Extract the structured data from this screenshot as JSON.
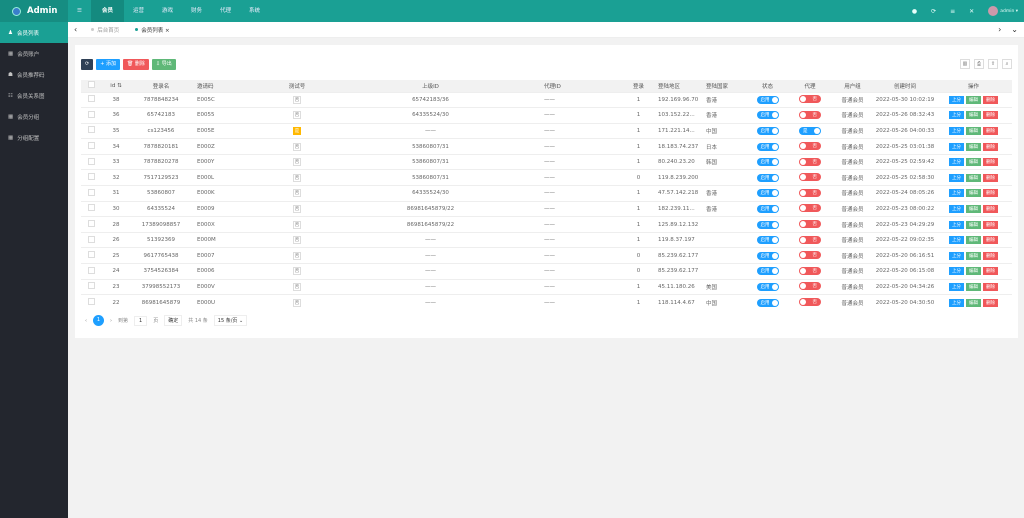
{
  "header": {
    "logo": "Admin",
    "nav": [
      "☰",
      "会员",
      "运营",
      "游戏",
      "财务",
      "代理",
      "系统"
    ],
    "active_nav": 1,
    "icons": [
      "●",
      "⟳",
      "≡",
      "✕"
    ],
    "user": "admin ▾"
  },
  "sidebar": {
    "items": [
      {
        "icon": "♟",
        "label": "会员列表"
      },
      {
        "icon": "▦",
        "label": "会员账户"
      },
      {
        "icon": "☗",
        "label": "会员推荐码"
      },
      {
        "icon": "☷",
        "label": "会员关系图"
      },
      {
        "icon": "▦",
        "label": "会员分组"
      },
      {
        "icon": "▦",
        "label": "分组配置"
      }
    ]
  },
  "tabs": {
    "back": "‹",
    "items": [
      "后台首页",
      "会员列表 ×"
    ],
    "fwd": "›",
    "more": "⌄"
  },
  "toolbar": {
    "refresh": "⟳",
    "add": "+ 添加",
    "delete": "🗑 删除",
    "export": "⇩ 导出"
  },
  "right_tools": [
    "▥",
    "⎙",
    "⇪",
    "⌕"
  ],
  "table": {
    "headers": [
      "id ⇅",
      "登录名",
      "邀请码",
      "测试号",
      "上级ID",
      "代理ID",
      "登录",
      "登陆地区",
      "登陆国家",
      "状态",
      "代理",
      "用户组",
      "创建时间",
      "操作"
    ],
    "rows": [
      [
        "38",
        "7878848234",
        "E005C",
        "否",
        "65742183/36",
        "——",
        "1",
        "192.169.96.70",
        "香港",
        "启用",
        "否",
        "普通会员",
        "2022-05-30 10:02:19"
      ],
      [
        "36",
        "65742183",
        "E0055",
        "否",
        "64335524/30",
        "——",
        "1",
        "103.152.22...",
        "香港",
        "启用",
        "否",
        "普通会员",
        "2022-05-26 08:32:43"
      ],
      [
        "35",
        "cs123456",
        "E005E",
        "是",
        "——",
        "——",
        "1",
        "171.221.14...",
        "中国",
        "启用",
        "是",
        "普通会员",
        "2022-05-26 04:00:33"
      ],
      [
        "34",
        "7878820181",
        "E000Z",
        "否",
        "53860807/31",
        "——",
        "1",
        "18.183.74.237",
        "日本",
        "启用",
        "否",
        "普通会员",
        "2022-05-25 03:01:38"
      ],
      [
        "33",
        "7878820278",
        "E000Y",
        "否",
        "53860807/31",
        "——",
        "1",
        "80.240.23.20",
        "韩国",
        "启用",
        "否",
        "普通会员",
        "2022-05-25 02:59:42"
      ],
      [
        "32",
        "7517129523",
        "E000L",
        "否",
        "53860807/31",
        "——",
        "0",
        "119.8.239.200",
        "",
        "启用",
        "否",
        "普通会员",
        "2022-05-25 02:58:30"
      ],
      [
        "31",
        "53860807",
        "E000K",
        "否",
        "64335524/30",
        "——",
        "1",
        "47.57.142.218",
        "香港",
        "启用",
        "否",
        "普通会员",
        "2022-05-24 08:05:26"
      ],
      [
        "30",
        "64335524",
        "E0009",
        "否",
        "86981645879/22",
        "——",
        "1",
        "182.239.11...",
        "香港",
        "启用",
        "否",
        "普通会员",
        "2022-05-23 08:00:22"
      ],
      [
        "28",
        "17389098857",
        "E000X",
        "否",
        "86981645879/22",
        "——",
        "1",
        "125.89.12.132",
        "",
        "启用",
        "否",
        "普通会员",
        "2022-05-23 04:29:29"
      ],
      [
        "26",
        "51392369",
        "E000M",
        "否",
        "——",
        "——",
        "1",
        "119.8.37.197",
        "",
        "启用",
        "否",
        "普通会员",
        "2022-05-22 09:02:35"
      ],
      [
        "25",
        "9617765438",
        "E0007",
        "否",
        "——",
        "——",
        "0",
        "85.239.62.177",
        "",
        "启用",
        "否",
        "普通会员",
        "2022-05-20 06:16:51"
      ],
      [
        "24",
        "3754526384",
        "E0006",
        "否",
        "——",
        "——",
        "0",
        "85.239.62.177",
        "",
        "启用",
        "否",
        "普通会员",
        "2022-05-20 06:15:08"
      ],
      [
        "23",
        "37998552173",
        "E000V",
        "否",
        "——",
        "——",
        "1",
        "45.11.180.26",
        "美国",
        "启用",
        "否",
        "普通会员",
        "2022-05-20 04:34:26"
      ],
      [
        "22",
        "86981645879",
        "E000U",
        "否",
        "——",
        "——",
        "1",
        "118.114.4.67",
        "中国",
        "启用",
        "否",
        "普通会员",
        "2022-05-20 04:30:50"
      ]
    ],
    "actions": [
      "上分",
      "编辑",
      "删除"
    ]
  },
  "pagination": {
    "prev": "‹",
    "current": "1",
    "next": "›",
    "goto": "到第",
    "page": "1",
    "page_unit": "页",
    "confirm": "确定",
    "total": "共 14 条",
    "size": "15 条/页 ⌄"
  },
  "colors": {
    "primary": "#1aa094",
    "blue": "#1e9fff",
    "red": "#f0585a",
    "green": "#5fb878",
    "yellow": "#ffb800"
  }
}
